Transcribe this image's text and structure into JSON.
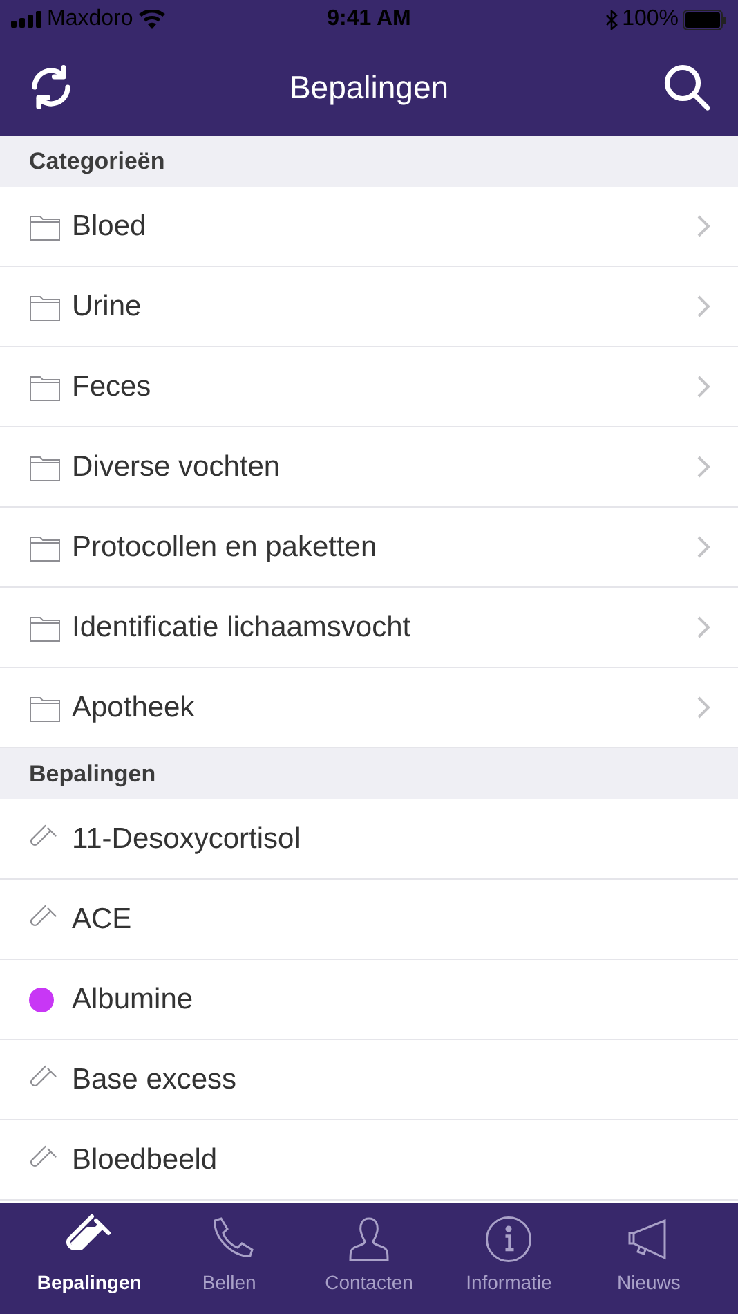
{
  "status_bar": {
    "carrier": "Maxdoro",
    "time": "9:41 AM",
    "battery": "100%"
  },
  "nav": {
    "title": "Bepalingen"
  },
  "sections": [
    {
      "header": "Categorieën",
      "items": [
        {
          "kind": "folder",
          "label": "Bloed"
        },
        {
          "kind": "folder",
          "label": "Urine"
        },
        {
          "kind": "folder",
          "label": "Feces"
        },
        {
          "kind": "folder",
          "label": "Diverse vochten"
        },
        {
          "kind": "folder",
          "label": "Protocollen en paketten"
        },
        {
          "kind": "folder",
          "label": "Identificatie lichaamsvocht"
        },
        {
          "kind": "folder",
          "label": "Apotheek"
        }
      ]
    },
    {
      "header": "Bepalingen",
      "items": [
        {
          "kind": "tube",
          "label": "11-Desoxycortisol"
        },
        {
          "kind": "tube",
          "label": "ACE"
        },
        {
          "kind": "dot",
          "label": "Albumine",
          "color": "#c837f5"
        },
        {
          "kind": "tube",
          "label": "Base excess"
        },
        {
          "kind": "tube",
          "label": "Bloedbeeld"
        }
      ]
    }
  ],
  "tab_bar": [
    {
      "kind": "tube",
      "label": "Bepalingen",
      "selected": true
    },
    {
      "kind": "phone",
      "label": "Bellen",
      "selected": false
    },
    {
      "kind": "person",
      "label": "Contacten",
      "selected": false
    },
    {
      "kind": "info",
      "label": "Informatie",
      "selected": false
    },
    {
      "kind": "megaphone",
      "label": "Nieuws",
      "selected": false
    }
  ]
}
